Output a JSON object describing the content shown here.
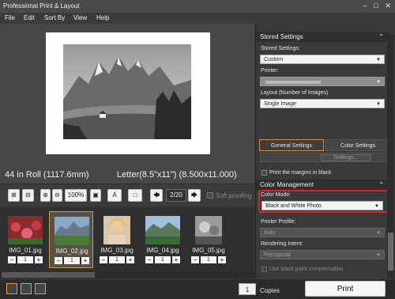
{
  "window": {
    "title": "Professional Print & Layout"
  },
  "menu": [
    "File",
    "Edit",
    "Sort By",
    "View",
    "Help"
  ],
  "preview": {
    "roll_info": "44 in Roll (1117.6mm)",
    "paper_info": "Letter(8.5\"x11\") (8.500x11.000)"
  },
  "toolbar": {
    "zoom": "100%",
    "page": "2/20",
    "soft_proofing": "Soft proofing",
    "A_label": "A"
  },
  "thumbnails": [
    {
      "name": "IMG_01.jpg",
      "count": "1",
      "selected": false
    },
    {
      "name": "IMG_02.jpg",
      "count": "1",
      "selected": true
    },
    {
      "name": "IMG_03.jpg",
      "count": "1",
      "selected": false
    },
    {
      "name": "IMG_04.jpg",
      "count": "1",
      "selected": false
    },
    {
      "name": "IMG_05.jpg",
      "count": "1",
      "selected": false
    }
  ],
  "panel": {
    "stored_settings_header": "Stored Settings",
    "stored_settings_label": "Stored Settings:",
    "stored_settings_value": "Custom",
    "printer_label": "Printer:",
    "layout_label": "Layout (Number of Images)",
    "layout_value": "Single Image",
    "tab_general": "General Settings",
    "tab_color": "Color Settings",
    "settings_button": "Settings...",
    "print_margins": "Print the margins in black",
    "color_mgmt_header": "Color Management",
    "color_mode_label": "Color Mode:",
    "color_mode_value": "Black and White Photo",
    "printer_profile_label": "Printer Profile:",
    "printer_profile_value": "Auto",
    "rendering_intent_label": "Rendering Intent:",
    "rendering_intent_value": "Perceptual",
    "bpc": "Use black point compensation"
  },
  "status": {
    "copies": "1",
    "copies_label": "Copies",
    "print_button": "Print"
  },
  "colors": {
    "accent": "#d88a2f",
    "highlight": "#e0202a"
  }
}
